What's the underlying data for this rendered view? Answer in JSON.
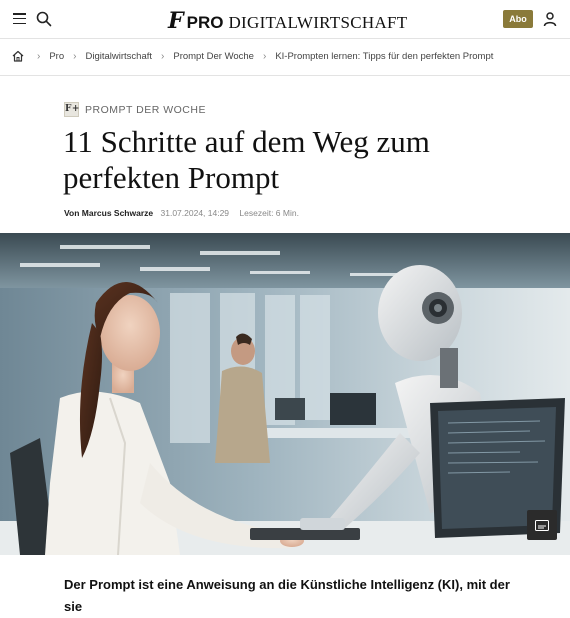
{
  "header": {
    "logo_mark": "F",
    "logo_pro": "PRO",
    "logo_section": "DIGITALWIRTSCHAFT",
    "abo_label": "Abo"
  },
  "breadcrumb": {
    "items": [
      "Pro",
      "Digitalwirtschaft",
      "Prompt Der Woche",
      "KI-Prompten lernen: Tipps für den perfekten Prompt"
    ],
    "separator": "›"
  },
  "article": {
    "kicker_badge": "F+",
    "kicker": "PROMPT DER WOCHE",
    "title": "11 Schritte auf dem Weg zum perfekten Prompt",
    "author": "Von Marcus Schwarze",
    "date": "31.07.2024, 14:29",
    "reading_time": "Lesezeit: 6 Min.",
    "lead": "Der Prompt ist eine Anweisung an die Künstliche Intelligenz (KI), mit der sie"
  },
  "icons": {
    "menu": "hamburger-menu-icon",
    "search": "search-icon",
    "user": "user-icon",
    "home": "home-icon",
    "caption": "caption-icon"
  },
  "colors": {
    "abo": "#8a7a3a",
    "text": "#111111",
    "muted": "#888888"
  }
}
